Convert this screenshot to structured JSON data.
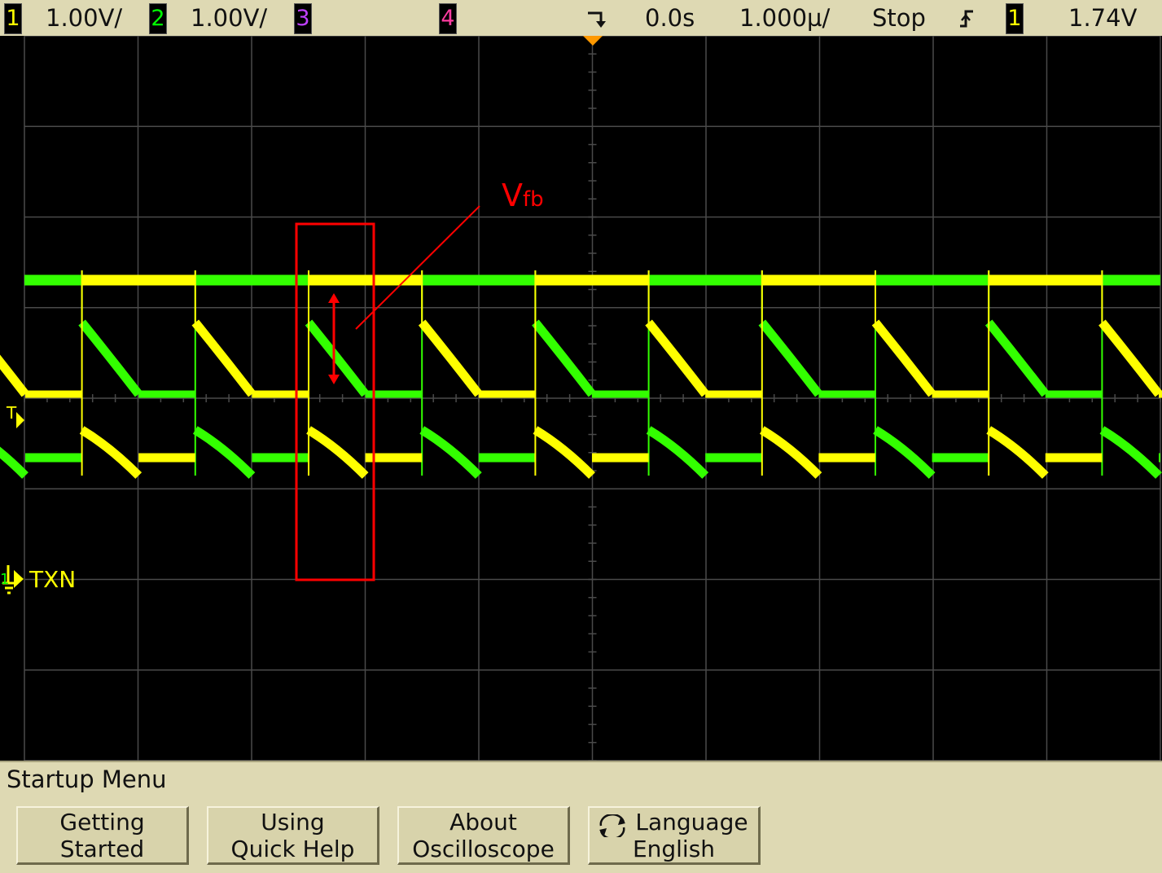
{
  "status_bar": {
    "ch1": {
      "num": "1",
      "scale": "1.00V/",
      "color": "#ffff00"
    },
    "ch2": {
      "num": "2",
      "scale": "1.00V/",
      "color": "#00ff00"
    },
    "ch3": {
      "num": "3",
      "color": "#c040ff"
    },
    "ch4": {
      "num": "4",
      "color": "#ff3ca0"
    },
    "time_delay": "0.0s",
    "timebase": "1.000µ/",
    "run_state": "Stop",
    "trigger_slope_icon": "rising-edge-icon",
    "trigger_source": "1",
    "trigger_level": "1.74V"
  },
  "display": {
    "trace_label": "TXN",
    "trigger_marker": "T",
    "trigger_position_icon": "trigger-position-icon",
    "colors": {
      "ch1": "#ffff00",
      "ch2": "#33ff00",
      "grid": "#4a4a4a",
      "annotation": "#ff0000",
      "trigger_marker": "#ff9900"
    }
  },
  "annotation": {
    "label": "V",
    "subscript": "fb"
  },
  "menu": {
    "title": "Startup Menu",
    "softkeys": [
      {
        "line1": "Getting",
        "line2": "Started"
      },
      {
        "line1": "Using",
        "line2": "Quick Help"
      },
      {
        "line1": "About",
        "line2": "Oscilloscope"
      },
      {
        "line1": "Language",
        "line2": "English",
        "icon": "cycle-icon"
      }
    ]
  }
}
